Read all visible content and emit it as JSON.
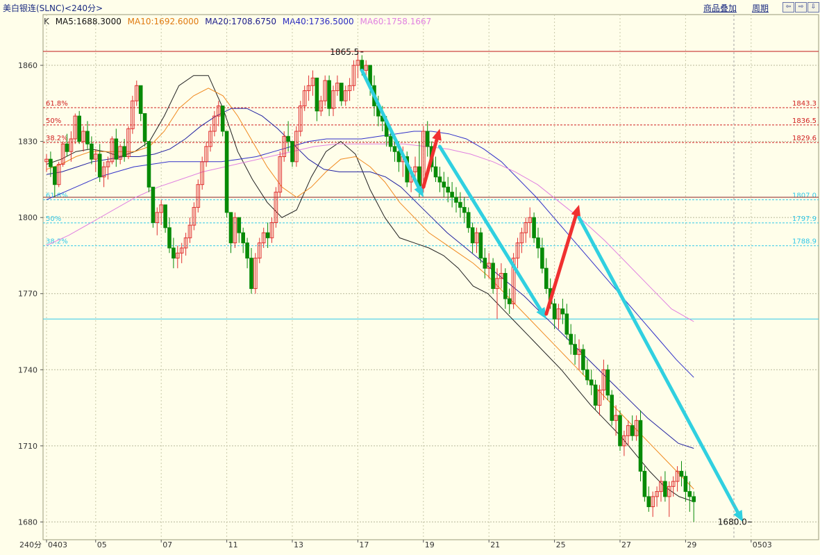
{
  "header": {
    "title": "美白银连(SLNC)<240分>",
    "overlay_link": "商品叠加",
    "period_link": "周期",
    "nav_buttons": [
      "⇦",
      "⇨",
      "⇩"
    ]
  },
  "legend": {
    "k_label": "K",
    "ma5": "MA5:1688.3000",
    "ma10": "MA10:1692.6000",
    "ma20": "MA20:1708.6750",
    "ma40": "MA40:1736.5000",
    "ma60": "MA60:1758.1667"
  },
  "colors": {
    "background": "#fffeea",
    "up": "#e03030",
    "down": "#078a07",
    "ma5": "#202020",
    "ma10": "#f08a20",
    "ma20": "#2020a0",
    "ma40": "#3030c8",
    "ma60": "#e080e0",
    "fib_upper": "#d02020",
    "fib_lower": "#30c8e8",
    "arrow_down": "#30d0e0",
    "arrow_up": "#f03030"
  },
  "chart_data": {
    "type": "candlestick",
    "period_label": "240分",
    "y_ticks": [
      1860,
      1830,
      1800,
      1770,
      1740,
      1710,
      1680
    ],
    "ylim": [
      1673,
      1880
    ],
    "x_ticks": [
      {
        "label": "0403",
        "i": 0
      },
      {
        "label": "05",
        "i": 12
      },
      {
        "label": "07",
        "i": 28
      },
      {
        "label": "11",
        "i": 44
      },
      {
        "label": "13",
        "i": 60
      },
      {
        "label": "17",
        "i": 76
      },
      {
        "label": "19",
        "i": 92
      },
      {
        "label": "21",
        "i": 108
      },
      {
        "label": "25",
        "i": 124
      },
      {
        "label": "27",
        "i": 140
      },
      {
        "label": "29",
        "i": 156
      },
      {
        "label": "0503",
        "i": 172
      }
    ],
    "annotations": {
      "high_label": "1865.5",
      "high_value": 1865.5,
      "high_index": 77,
      "low_label": "1680.0",
      "low_value": 1680.0,
      "low_index": 172
    },
    "fib_upper": [
      {
        "label": "61.8%",
        "value": 1843.3,
        "value_label": "1843.3"
      },
      {
        "label": "50%",
        "value": 1836.5,
        "value_label": "1836.5"
      },
      {
        "label": "38.2%",
        "value": 1829.6,
        "value_label": "1829.6"
      }
    ],
    "fib_lower": [
      {
        "label": "61.8%",
        "value": 1807.0,
        "value_label": "1807.0"
      },
      {
        "label": "50%",
        "value": 1797.9,
        "value_label": "1797.9"
      },
      {
        "label": "38.2%",
        "value": 1788.9,
        "value_label": "1788.9"
      }
    ],
    "hlines": [
      {
        "value": 1865.5,
        "color": "#c01818"
      },
      {
        "value": 1808.0,
        "color": "#8a2020"
      },
      {
        "value": 1760.0,
        "color": "#30c8e8"
      }
    ],
    "arrows": [
      {
        "from": [
          77,
          1858
        ],
        "to": [
          92,
          1808
        ],
        "color": "down"
      },
      {
        "from": [
          92,
          1812
        ],
        "to": [
          96,
          1835
        ],
        "color": "up"
      },
      {
        "from": [
          96,
          1828
        ],
        "to": [
          122,
          1760
        ],
        "color": "down"
      },
      {
        "from": [
          122,
          1762
        ],
        "to": [
          130,
          1805
        ],
        "color": "up"
      },
      {
        "from": [
          130,
          1800
        ],
        "to": [
          170,
          1680
        ],
        "color": "down"
      }
    ],
    "candles": [
      [
        1822,
        1825,
        1818,
        1823
      ],
      [
        1823,
        1826,
        1816,
        1820
      ],
      [
        1820,
        1818,
        1808,
        1813
      ],
      [
        1813,
        1822,
        1812,
        1821
      ],
      [
        1821,
        1830,
        1820,
        1829
      ],
      [
        1829,
        1833,
        1824,
        1826
      ],
      [
        1826,
        1834,
        1822,
        1831
      ],
      [
        1831,
        1841,
        1829,
        1840
      ],
      [
        1840,
        1842,
        1829,
        1830
      ],
      [
        1830,
        1836,
        1826,
        1834
      ],
      [
        1834,
        1838,
        1827,
        1829
      ],
      [
        1829,
        1832,
        1821,
        1823
      ],
      [
        1823,
        1827,
        1818,
        1825
      ],
      [
        1825,
        1829,
        1814,
        1816
      ],
      [
        1816,
        1822,
        1812,
        1820
      ],
      [
        1820,
        1824,
        1815,
        1822
      ],
      [
        1822,
        1832,
        1821,
        1831
      ],
      [
        1831,
        1835,
        1820,
        1823
      ],
      [
        1823,
        1829,
        1821,
        1828
      ],
      [
        1828,
        1831,
        1822,
        1824
      ],
      [
        1824,
        1836,
        1823,
        1835
      ],
      [
        1835,
        1848,
        1833,
        1846
      ],
      [
        1846,
        1854,
        1844,
        1852
      ],
      [
        1852,
        1849,
        1838,
        1841
      ],
      [
        1841,
        1837,
        1828,
        1830
      ],
      [
        1830,
        1826,
        1810,
        1812
      ],
      [
        1812,
        1809,
        1796,
        1798
      ],
      [
        1798,
        1804,
        1793,
        1802
      ],
      [
        1802,
        1807,
        1797,
        1805
      ],
      [
        1805,
        1804,
        1794,
        1796
      ],
      [
        1796,
        1800,
        1786,
        1788
      ],
      [
        1788,
        1792,
        1780,
        1784
      ],
      [
        1784,
        1789,
        1780,
        1786
      ],
      [
        1786,
        1790,
        1782,
        1788
      ],
      [
        1788,
        1794,
        1785,
        1792
      ],
      [
        1792,
        1800,
        1790,
        1797
      ],
      [
        1797,
        1806,
        1795,
        1804
      ],
      [
        1804,
        1815,
        1802,
        1813
      ],
      [
        1813,
        1824,
        1811,
        1822
      ],
      [
        1822,
        1830,
        1820,
        1828
      ],
      [
        1828,
        1836,
        1826,
        1834
      ],
      [
        1834,
        1842,
        1832,
        1840
      ],
      [
        1840,
        1846,
        1836,
        1844
      ],
      [
        1844,
        1842,
        1832,
        1834
      ],
      [
        1834,
        1830,
        1800,
        1802
      ],
      [
        1802,
        1798,
        1786,
        1790
      ],
      [
        1790,
        1802,
        1788,
        1800
      ],
      [
        1800,
        1798,
        1790,
        1794
      ],
      [
        1794,
        1796,
        1786,
        1790
      ],
      [
        1790,
        1792,
        1780,
        1784
      ],
      [
        1784,
        1788,
        1770,
        1772
      ],
      [
        1772,
        1786,
        1770,
        1784
      ],
      [
        1784,
        1792,
        1782,
        1790
      ],
      [
        1790,
        1796,
        1788,
        1794
      ],
      [
        1794,
        1798,
        1788,
        1792
      ],
      [
        1792,
        1800,
        1790,
        1798
      ],
      [
        1798,
        1812,
        1796,
        1810
      ],
      [
        1810,
        1826,
        1808,
        1824
      ],
      [
        1824,
        1834,
        1822,
        1832
      ],
      [
        1832,
        1838,
        1826,
        1830
      ],
      [
        1830,
        1826,
        1820,
        1822
      ],
      [
        1822,
        1836,
        1820,
        1834
      ],
      [
        1834,
        1846,
        1832,
        1844
      ],
      [
        1844,
        1852,
        1842,
        1850
      ],
      [
        1850,
        1856,
        1846,
        1852
      ],
      [
        1852,
        1858,
        1848,
        1855
      ],
      [
        1855,
        1850,
        1838,
        1842
      ],
      [
        1842,
        1848,
        1840,
        1846
      ],
      [
        1846,
        1856,
        1844,
        1854
      ],
      [
        1854,
        1856,
        1840,
        1843
      ],
      [
        1843,
        1852,
        1840,
        1850
      ],
      [
        1850,
        1856,
        1848,
        1853
      ],
      [
        1853,
        1851,
        1844,
        1846
      ],
      [
        1846,
        1852,
        1844,
        1850
      ],
      [
        1850,
        1855,
        1846,
        1852
      ],
      [
        1852,
        1862,
        1850,
        1860
      ],
      [
        1860,
        1866,
        1855,
        1862
      ],
      [
        1862,
        1864,
        1856,
        1858
      ],
      [
        1858,
        1862,
        1854,
        1860
      ],
      [
        1860,
        1858,
        1848,
        1852
      ],
      [
        1852,
        1856,
        1840,
        1844
      ],
      [
        1844,
        1848,
        1836,
        1840
      ],
      [
        1840,
        1844,
        1834,
        1838
      ],
      [
        1838,
        1840,
        1828,
        1832
      ],
      [
        1832,
        1834,
        1826,
        1828
      ],
      [
        1828,
        1832,
        1822,
        1826
      ],
      [
        1826,
        1830,
        1818,
        1822
      ],
      [
        1822,
        1828,
        1816,
        1824
      ],
      [
        1824,
        1826,
        1812,
        1814
      ],
      [
        1814,
        1820,
        1810,
        1818
      ],
      [
        1818,
        1824,
        1814,
        1820
      ],
      [
        1820,
        1830,
        1808,
        1812
      ],
      [
        1812,
        1836,
        1810,
        1834
      ],
      [
        1834,
        1838,
        1824,
        1828
      ],
      [
        1828,
        1830,
        1818,
        1820
      ],
      [
        1820,
        1824,
        1814,
        1816
      ],
      [
        1816,
        1820,
        1810,
        1814
      ],
      [
        1814,
        1818,
        1808,
        1812
      ],
      [
        1812,
        1816,
        1806,
        1810
      ],
      [
        1810,
        1814,
        1804,
        1808
      ],
      [
        1808,
        1812,
        1802,
        1806
      ],
      [
        1806,
        1810,
        1800,
        1804
      ],
      [
        1804,
        1808,
        1798,
        1802
      ],
      [
        1802,
        1804,
        1794,
        1796
      ],
      [
        1796,
        1798,
        1786,
        1790
      ],
      [
        1790,
        1796,
        1786,
        1794
      ],
      [
        1794,
        1796,
        1782,
        1784
      ],
      [
        1784,
        1788,
        1776,
        1780
      ],
      [
        1780,
        1786,
        1776,
        1782
      ],
      [
        1782,
        1784,
        1770,
        1772
      ],
      [
        1772,
        1780,
        1760,
        1776
      ],
      [
        1776,
        1782,
        1772,
        1778
      ],
      [
        1778,
        1780,
        1764,
        1768
      ],
      [
        1768,
        1772,
        1762,
        1766
      ],
      [
        1766,
        1786,
        1764,
        1784
      ],
      [
        1784,
        1792,
        1780,
        1790
      ],
      [
        1790,
        1796,
        1786,
        1794
      ],
      [
        1794,
        1800,
        1790,
        1798
      ],
      [
        1798,
        1804,
        1792,
        1800
      ],
      [
        1800,
        1802,
        1790,
        1792
      ],
      [
        1792,
        1796,
        1784,
        1788
      ],
      [
        1788,
        1792,
        1778,
        1780
      ],
      [
        1780,
        1784,
        1770,
        1772
      ],
      [
        1772,
        1776,
        1764,
        1766
      ],
      [
        1766,
        1768,
        1756,
        1760
      ],
      [
        1760,
        1766,
        1756,
        1764
      ],
      [
        1764,
        1768,
        1758,
        1762
      ],
      [
        1762,
        1766,
        1752,
        1754
      ],
      [
        1754,
        1758,
        1746,
        1750
      ],
      [
        1750,
        1754,
        1742,
        1746
      ],
      [
        1746,
        1752,
        1740,
        1748
      ],
      [
        1748,
        1750,
        1738,
        1740
      ],
      [
        1740,
        1744,
        1734,
        1736
      ],
      [
        1736,
        1740,
        1730,
        1734
      ],
      [
        1734,
        1736,
        1724,
        1726
      ],
      [
        1726,
        1734,
        1722,
        1732
      ],
      [
        1732,
        1744,
        1728,
        1740
      ],
      [
        1740,
        1742,
        1728,
        1730
      ],
      [
        1730,
        1732,
        1718,
        1720
      ],
      [
        1720,
        1726,
        1714,
        1722
      ],
      [
        1722,
        1724,
        1708,
        1710
      ],
      [
        1710,
        1716,
        1706,
        1714
      ],
      [
        1714,
        1720,
        1710,
        1718
      ],
      [
        1718,
        1722,
        1712,
        1714
      ],
      [
        1714,
        1722,
        1712,
        1720
      ],
      [
        1720,
        1724,
        1696,
        1700
      ],
      [
        1700,
        1702,
        1688,
        1690
      ],
      [
        1690,
        1694,
        1684,
        1686
      ],
      [
        1686,
        1692,
        1682,
        1690
      ],
      [
        1690,
        1694,
        1686,
        1692
      ],
      [
        1692,
        1698,
        1688,
        1696
      ],
      [
        1696,
        1700,
        1688,
        1690
      ],
      [
        1690,
        1696,
        1682,
        1694
      ],
      [
        1694,
        1698,
        1690,
        1696
      ],
      [
        1696,
        1702,
        1692,
        1700
      ],
      [
        1700,
        1704,
        1694,
        1698
      ],
      [
        1698,
        1700,
        1688,
        1692
      ],
      [
        1692,
        1696,
        1684,
        1690
      ],
      [
        1690,
        1692,
        1680,
        1688
      ]
    ],
    "ma_series": [
      {
        "name": "MA5",
        "color": "#202020",
        "values": [
          1821,
          1823,
          1826,
          1827,
          1826,
          1824,
          1826,
          1830,
          1840,
          1852,
          1856,
          1856,
          1843,
          1826,
          1815,
          1806,
          1800,
          1803,
          1816,
          1826,
          1830,
          1825,
          1811,
          1800,
          1792,
          1790,
          1788,
          1785,
          1780,
          1773,
          1770,
          1764,
          1758,
          1752,
          1746,
          1740,
          1733,
          1726,
          1720,
          1714,
          1707,
          1700,
          1694,
          1690,
          1688
        ]
      },
      {
        "name": "MA10",
        "color": "#f08a20",
        "values": [
          1819,
          1821,
          1824,
          1826,
          1826,
          1826,
          1826,
          1828,
          1834,
          1843,
          1848,
          1851,
          1848,
          1840,
          1830,
          1820,
          1812,
          1808,
          1812,
          1818,
          1823,
          1824,
          1820,
          1814,
          1806,
          1800,
          1794,
          1790,
          1786,
          1782,
          1777,
          1771,
          1765,
          1759,
          1753,
          1747,
          1741,
          1735,
          1729,
          1723,
          1717,
          1711,
          1705,
          1699,
          1693
        ]
      },
      {
        "name": "MA20",
        "color": "#2020a0",
        "values": [
          1817,
          1818,
          1820,
          1822,
          1823,
          1824,
          1824,
          1825,
          1827,
          1831,
          1836,
          1840,
          1843,
          1843,
          1840,
          1835,
          1829,
          1823,
          1819,
          1818,
          1818,
          1818,
          1816,
          1812,
          1806,
          1800,
          1794,
          1789,
          1784,
          1779,
          1774,
          1769,
          1763,
          1757,
          1751,
          1745,
          1739,
          1733,
          1727,
          1721,
          1716,
          1711,
          1709
        ]
      },
      {
        "name": "MA40",
        "color": "#3030c8",
        "values": [
          1807,
          1810,
          1813,
          1816,
          1818,
          1820,
          1821,
          1822,
          1822,
          1822,
          1822,
          1823,
          1824,
          1826,
          1828,
          1830,
          1831,
          1831,
          1831,
          1832,
          1833,
          1834,
          1834,
          1833,
          1831,
          1827,
          1822,
          1815,
          1808,
          1800,
          1792,
          1784,
          1776,
          1768,
          1760,
          1752,
          1744,
          1737
        ]
      },
      {
        "name": "MA60",
        "color": "#e080e0",
        "values": [
          1789,
          1793,
          1798,
          1803,
          1808,
          1812,
          1815,
          1818,
          1820,
          1822,
          1824,
          1826,
          1828,
          1829,
          1829,
          1829,
          1829,
          1828,
          1827,
          1825,
          1822,
          1818,
          1813,
          1806,
          1799,
          1791,
          1782,
          1773,
          1764,
          1759
        ]
      }
    ]
  }
}
